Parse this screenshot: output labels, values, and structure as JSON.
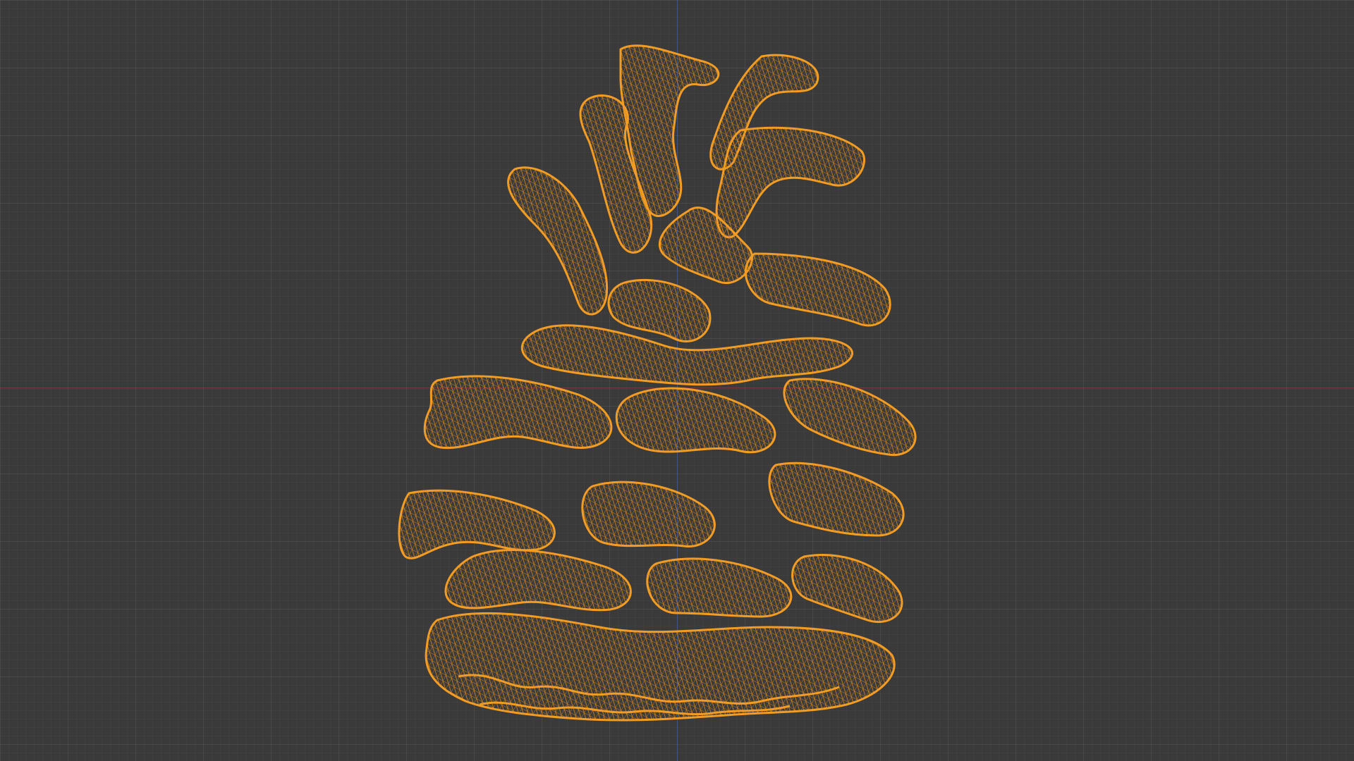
{
  "viewport": {
    "background_color": "#3a3a3a",
    "grid_color": "#4a4a4a",
    "x_axis_color": "#8a3b44",
    "y_axis_color": "#3e5a95",
    "display_mode": "wireframe"
  },
  "object": {
    "name": "pine-cone",
    "wire_color": "#f39c24"
  }
}
